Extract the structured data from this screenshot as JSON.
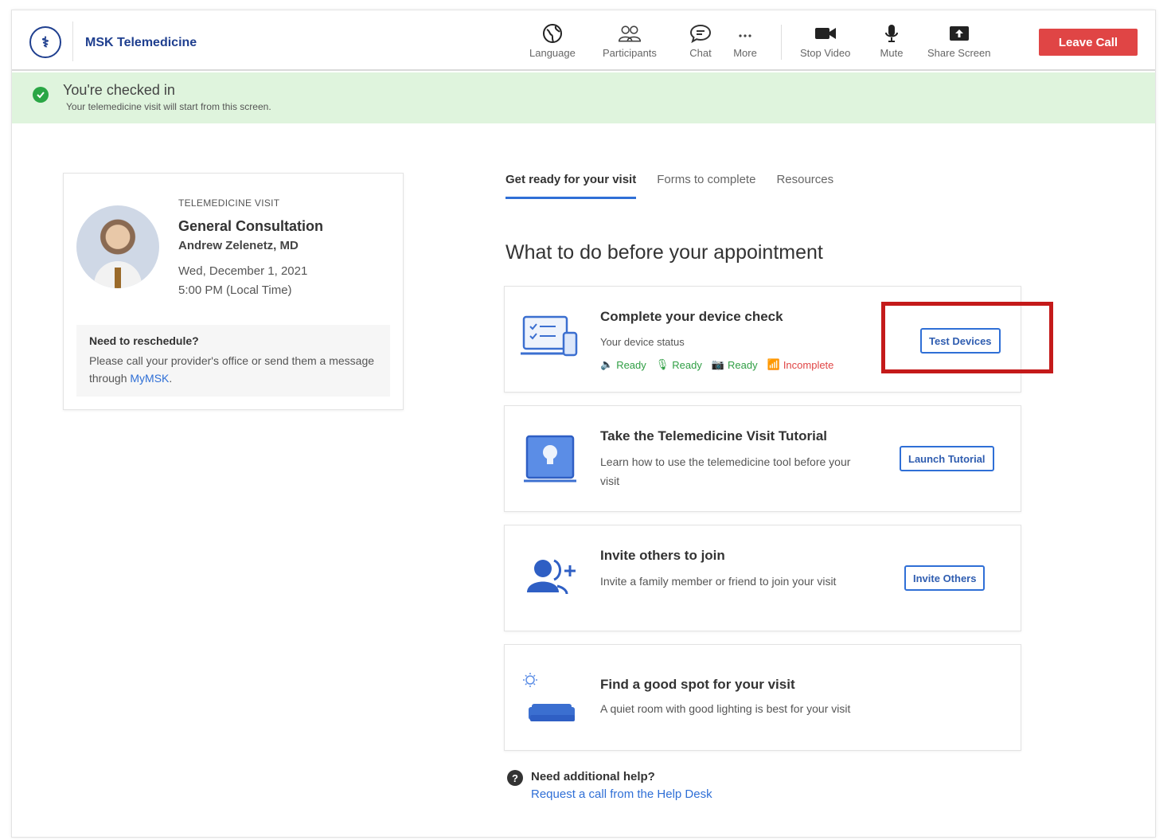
{
  "brand": "MSK Telemedicine",
  "toolbar": {
    "language": "Language",
    "participants": "Participants",
    "chat": "Chat",
    "more": "More",
    "stop_video": "Stop Video",
    "mute": "Mute",
    "share_screen": "Share Screen",
    "leave_call": "Leave Call"
  },
  "banner": {
    "title": "You're checked in",
    "subtitle": "Your telemedicine visit will start from this screen."
  },
  "appointment": {
    "kicker": "TELEMEDICINE VISIT",
    "title": "General Consultation",
    "doctor": "Andrew Zelenetz, MD",
    "date": "Wed, December 1, 2021",
    "time": "5:00 PM (Local Time)",
    "reschedule_title": "Need to reschedule?",
    "reschedule_text": "Please call your provider's office or send them a message through ",
    "reschedule_link": "MyMSK",
    "reschedule_end": "."
  },
  "tabs": [
    "Get ready for your visit",
    "Forms to complete",
    "Resources"
  ],
  "section_title": "What to do before your appointment",
  "tasks": {
    "device": {
      "title": "Complete your device check",
      "subtitle": "Your device status",
      "button": "Test Devices",
      "statuses": [
        "Ready",
        "Ready",
        "Ready",
        "Incomplete"
      ]
    },
    "tutorial": {
      "title": "Take the Telemedicine Visit Tutorial",
      "subtitle": "Learn how to use the telemedicine tool before your visit",
      "button": "Launch Tutorial"
    },
    "invite": {
      "title": "Invite others to join",
      "subtitle": "Invite a family member or friend to join your visit",
      "button": "Invite Others"
    },
    "spot": {
      "title": "Find a good spot for your visit",
      "subtitle": "A quiet room with good lighting is best for your visit"
    }
  },
  "help": {
    "title": "Need additional help?",
    "link": "Request a call from the Help Desk"
  },
  "colors": {
    "brand": "#1f3f8f",
    "accent": "#2f6fd6",
    "leave": "#e04545",
    "success": "#2aa645",
    "highlight": "#c41a1a"
  }
}
